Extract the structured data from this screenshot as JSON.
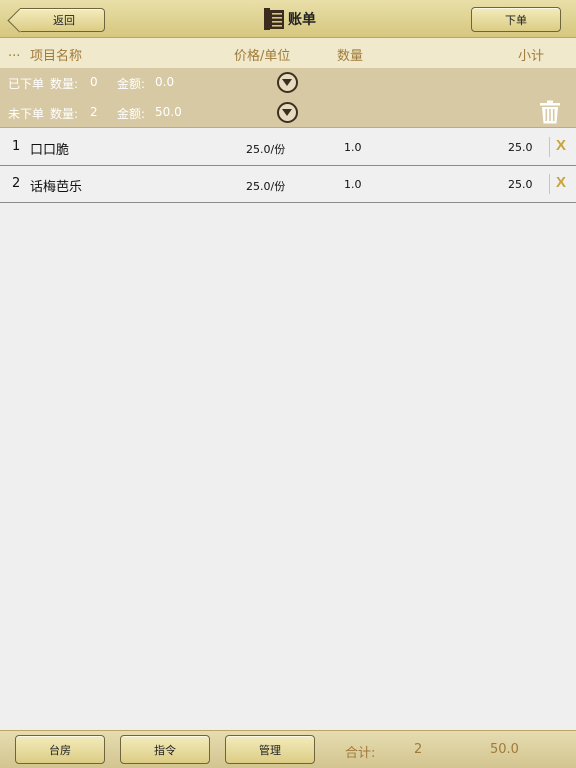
{
  "header": {
    "back_label": "返回",
    "title": "账单",
    "order_label": "下单"
  },
  "columns": {
    "dots": "...",
    "name": "项目名称",
    "price": "价格/单位",
    "qty": "数量",
    "subtotal": "小计"
  },
  "summary": {
    "ordered": {
      "label": "已下单",
      "qty_label": "数量:",
      "qty": "0",
      "amt_label": "金额:",
      "amt": "0.0"
    },
    "pending": {
      "label": "未下单",
      "qty_label": "数量:",
      "qty": "2",
      "amt_label": "金额:",
      "amt": "50.0"
    }
  },
  "items": [
    {
      "index": "1",
      "name": "口口脆",
      "price": "25.0/份",
      "qty": "1.0",
      "subtotal": "25.0",
      "remove": "X"
    },
    {
      "index": "2",
      "name": "话梅芭乐",
      "price": "25.0/份",
      "qty": "1.0",
      "subtotal": "25.0",
      "remove": "X"
    }
  ],
  "footer": {
    "btn1": "台房",
    "btn2": "指令",
    "btn3": "管理",
    "total_label": "合计:",
    "total_count": "2",
    "total_amount": "50.0"
  },
  "icons": {
    "title": "book-icon",
    "expand": "chevron-down-circle-icon",
    "clear": "trash-icon",
    "remove": "close-icon"
  },
  "colors": {
    "gold_bar": "#d6c77f",
    "accent_text": "#a07a3a",
    "summary_bg": "#d7c9a4",
    "remove_x": "#c9a43a"
  }
}
